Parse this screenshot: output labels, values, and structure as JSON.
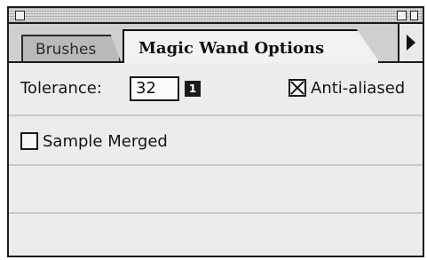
{
  "tabs": [
    {
      "label": "Brushes",
      "active": false
    },
    {
      "label": "Magic Wand Options",
      "active": true
    }
  ],
  "options": {
    "tolerance_label": "Tolerance:",
    "tolerance_value": "32",
    "badge": "1",
    "anti_aliased_label": "Anti-aliased",
    "anti_aliased_checked": true,
    "sample_merged_label": "Sample Merged",
    "sample_merged_checked": false
  }
}
